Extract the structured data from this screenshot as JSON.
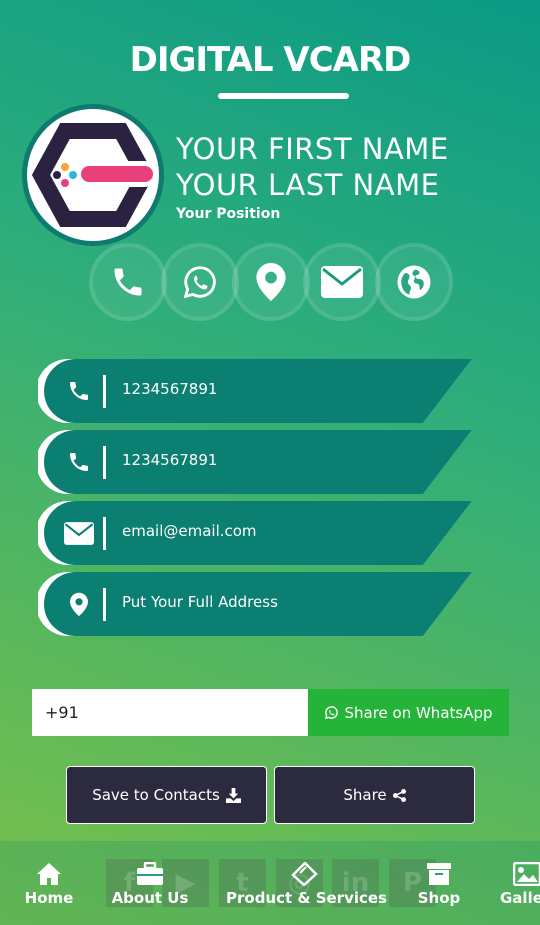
{
  "header": {
    "title": "DIGITAL VCARD"
  },
  "profile": {
    "first_name": "YOUR FIRST NAME",
    "last_name": "YOUR LAST NAME",
    "position": "Your Position",
    "logo_icon": "logo-hexagon"
  },
  "quick_actions": [
    {
      "name": "phone-icon"
    },
    {
      "name": "whatsapp-icon"
    },
    {
      "name": "location-icon"
    },
    {
      "name": "email-icon"
    },
    {
      "name": "globe-icon"
    }
  ],
  "contacts": [
    {
      "icon": "phone-icon",
      "text": "1234567891"
    },
    {
      "icon": "phone-icon",
      "text": "1234567891"
    },
    {
      "icon": "envelope-icon",
      "text": "email@email.com"
    },
    {
      "icon": "location-pin-icon",
      "text": "Put Your Full Address"
    }
  ],
  "share_form": {
    "phone_value": "+91",
    "whatsapp_label": "Share on WhatsApp"
  },
  "actions": {
    "save_label": "Save to Contacts",
    "share_label": "Share"
  },
  "social": [
    "facebook",
    "youtube",
    "twitter",
    "instagram",
    "linkedin",
    "pinterest"
  ],
  "nav": [
    {
      "label": "Home",
      "icon": "home-icon"
    },
    {
      "label": "About Us",
      "icon": "briefcase-icon"
    },
    {
      "label": "Product & Services",
      "icon": "ticket-icon"
    },
    {
      "label": "Shop",
      "icon": "archive-icon"
    },
    {
      "label": "Galle",
      "icon": "image-icon"
    }
  ],
  "colors": {
    "teal_dark": "#0a7f72",
    "whatsapp_green": "#25b33a",
    "button_dark": "#2c2a3e",
    "accent_pink": "#e8407a"
  }
}
